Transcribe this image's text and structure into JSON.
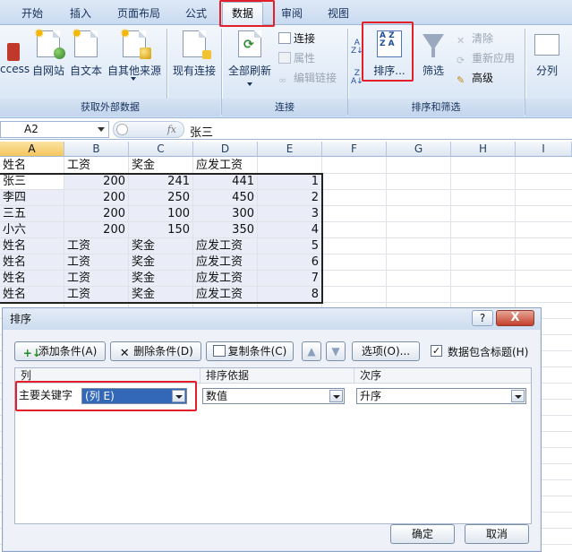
{
  "tabs": [
    "开始",
    "插入",
    "页面布局",
    "公式",
    "数据",
    "审阅",
    "视图"
  ],
  "active_tab": "数据",
  "ribbon": {
    "get_external": {
      "access": "ccess",
      "web": "自网站",
      "text": "自文本",
      "other": "自其他来源",
      "existing": "现有连接",
      "group": "获取外部数据"
    },
    "connections": {
      "refresh_all": "全部刷新",
      "connections": "连接",
      "properties": "属性",
      "edit_links": "编辑链接",
      "group": "连接"
    },
    "sort_filter": {
      "sort": "排序...",
      "filter": "筛选",
      "clear": "清除",
      "reapply": "重新应用",
      "advanced": "高级",
      "group": "排序和筛选"
    },
    "data_tools": {
      "text_to_cols": "分列"
    }
  },
  "formula_bar": {
    "name_box": "A2",
    "fx": "fx",
    "value": "张三"
  },
  "columns": [
    "A",
    "B",
    "C",
    "D",
    "E",
    "F",
    "G",
    "H",
    "I"
  ],
  "rows": [
    [
      "姓名",
      "工资",
      "奖金",
      "应发工资",
      ""
    ],
    [
      "张三",
      "200",
      "241",
      "441",
      "1"
    ],
    [
      "李四",
      "200",
      "250",
      "450",
      "2"
    ],
    [
      "三五",
      "200",
      "100",
      "300",
      "3"
    ],
    [
      "小六",
      "200",
      "150",
      "350",
      "4"
    ],
    [
      "姓名",
      "工资",
      "奖金",
      "应发工资",
      "5"
    ],
    [
      "姓名",
      "工资",
      "奖金",
      "应发工资",
      "6"
    ],
    [
      "姓名",
      "工资",
      "奖金",
      "应发工资",
      "7"
    ],
    [
      "姓名",
      "工资",
      "奖金",
      "应发工资",
      "8"
    ]
  ],
  "dialog": {
    "title": "排序",
    "help": "?",
    "close": "X",
    "add_level": "添加条件(A)",
    "delete_level": "删除条件(D)",
    "copy_level": "复制条件(C)",
    "options": "选项(O)...",
    "has_headers": "数据包含标题(H)",
    "has_headers_checked": true,
    "col_header": "列",
    "sort_on_header": "排序依据",
    "order_header": "次序",
    "primary_key": "主要关键字",
    "column_value": "(列 E)",
    "sort_on_value": "数值",
    "order_value": "升序",
    "ok": "确定",
    "cancel": "取消"
  },
  "colors": {
    "highlight": "#e3202a",
    "selected_combo": "#3367b8",
    "ribbon_bg": "#dbe7f5"
  }
}
